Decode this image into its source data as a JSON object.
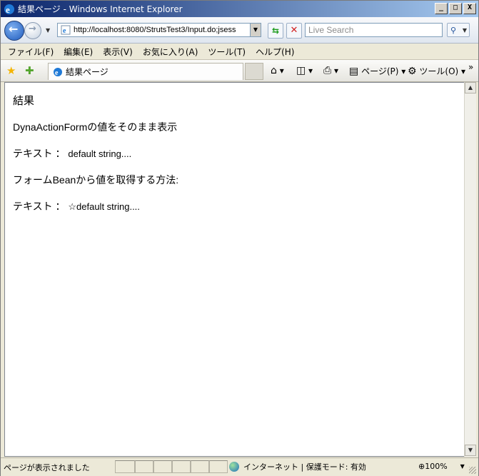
{
  "window": {
    "title": "結果ページ - Windows Internet Explorer",
    "buttons": [
      "_",
      "□",
      "X"
    ]
  },
  "nav": {
    "address": "http://localhost:8080/StrutsTest3/Input.do;jsess",
    "search_placeholder": "Live Search"
  },
  "menu": {
    "items": [
      "ファイル(F)",
      "編集(E)",
      "表示(V)",
      "お気に入り(A)",
      "ツール(T)",
      "ヘルプ(H)"
    ]
  },
  "toolbar": {
    "tab_label": "結果ページ",
    "page_label": "ページ(P)",
    "tools_label": "ツール(O)",
    "more": "»"
  },
  "page": {
    "heading": "結果",
    "line1": "DynaActionFormの値をそのまま表示",
    "line2_label": "テキスト ：",
    "line2_value": "default string....",
    "line3": "フォームBeanから値を取得する方法:",
    "line4_label": "テキスト ：",
    "line4_value": "☆default string...."
  },
  "status": {
    "text": "ページが表示されました",
    "zone": "インターネット | 保護モード: 有効",
    "zoom": "100%"
  },
  "colors": {
    "titlebar_start": "#0a246a",
    "titlebar_end": "#a6caf0",
    "chrome": "#ece9d8"
  }
}
